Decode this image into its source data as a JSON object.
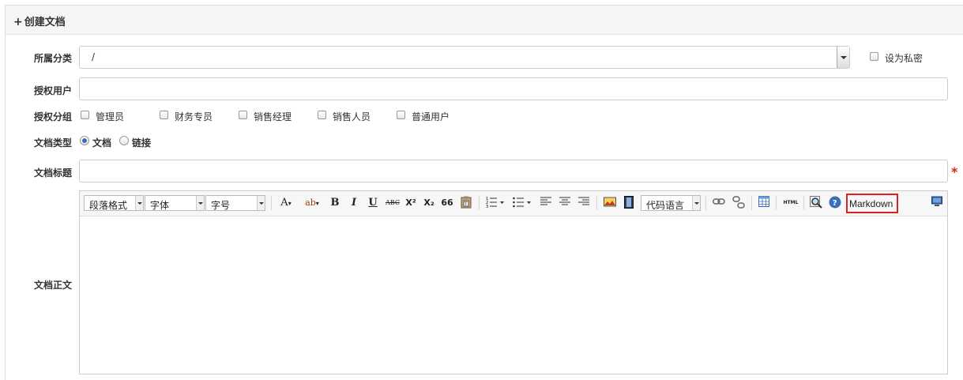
{
  "panel": {
    "title": "创建文档",
    "plus": "+"
  },
  "form": {
    "category": {
      "label": "所属分类",
      "value": "/"
    },
    "private": {
      "label": "设为私密"
    },
    "auth_users": {
      "label": "授权用户",
      "value": ""
    },
    "auth_groups": {
      "label": "授权分组",
      "options": [
        "管理员",
        "财务专员",
        "销售经理",
        "销售人员",
        "普通用户"
      ]
    },
    "doc_type": {
      "label": "文档类型",
      "options": [
        "文档",
        "链接"
      ],
      "selected": "文档"
    },
    "doc_title": {
      "label": "文档标题",
      "value": "",
      "required_mark": "*"
    },
    "doc_body": {
      "label": "文档正文"
    }
  },
  "toolbar": {
    "paragraph": "段落格式",
    "font": "字体",
    "size": "字号",
    "code_lang": "代码语言",
    "markdown": "Markdown",
    "btn_font_color": "A",
    "btn_highlight": "ab",
    "btn_bold": "B",
    "btn_italic": "I",
    "btn_underline": "U",
    "btn_strike": "ABC",
    "btn_sup": "X²",
    "btn_sub": "X₂",
    "btn_quote": "66",
    "btn_html": "HTML"
  },
  "colors": {
    "accent": "#3a6fb7",
    "required": "#d9251d",
    "markdown_highlight": "#e02020"
  }
}
